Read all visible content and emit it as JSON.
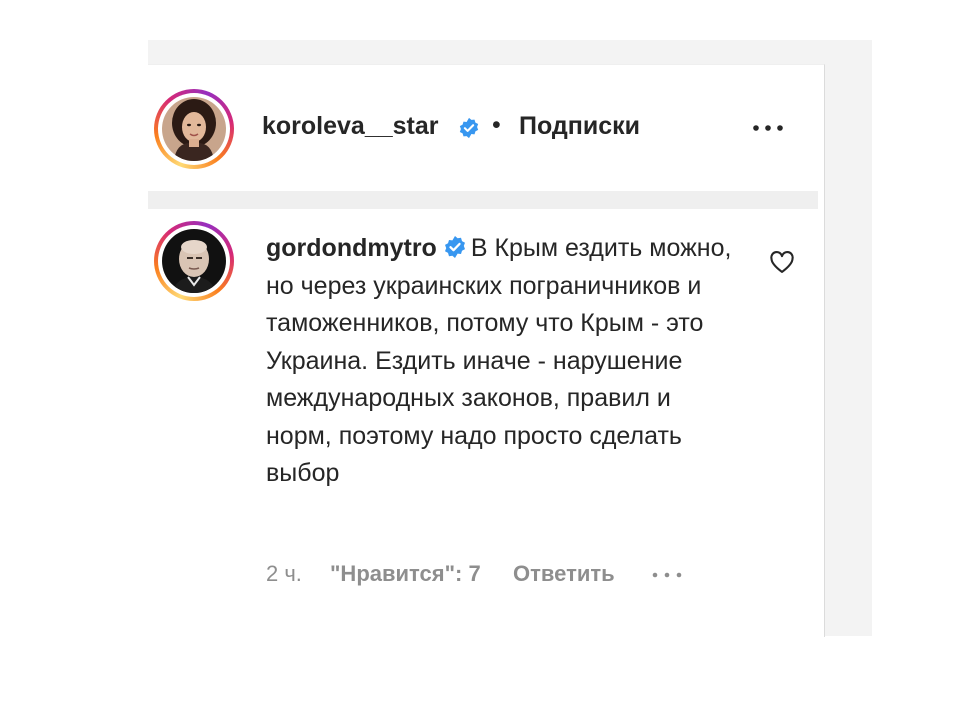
{
  "post": {
    "author": "koroleva__star",
    "separator": "•",
    "follow_status": "Подписки",
    "more_icon": "more-horizontal-icon",
    "verified_icon": "verified-badge-icon"
  },
  "comment": {
    "author": "gordondmytro",
    "text": "В Крым ездить можно, но через украинских пограничников и таможенников, потому что Крым - это Украина. Ездить иначе - нарушение международных законов, правил и норм, поэтому надо просто сделать выбор",
    "time": "2 ч.",
    "likes": "\"Нравится\": 7",
    "reply": "Ответить",
    "like_icon": "heart-icon",
    "more_icon": "more-horizontal-icon"
  },
  "colors": {
    "text": "#262626",
    "muted": "#8e8e8e",
    "verified": "#3897f0",
    "divider": "#efefef"
  }
}
